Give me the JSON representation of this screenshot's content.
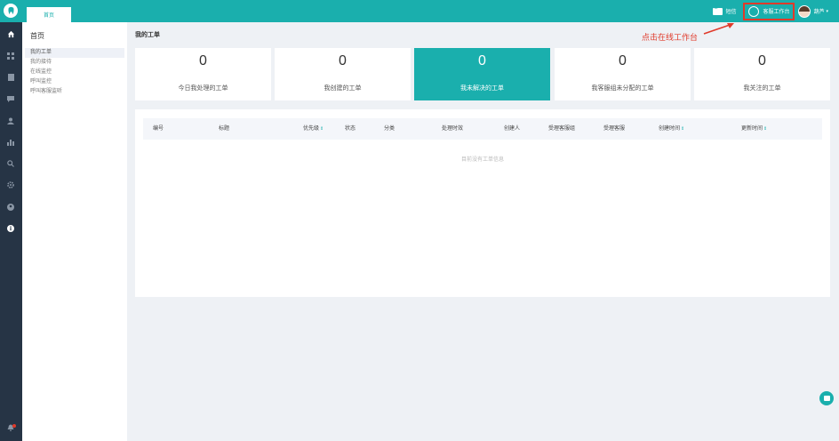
{
  "topbar": {
    "tab_home": "首页",
    "sms_label": "短信",
    "workbench_label": "客服工作台",
    "user_name": "葫芦",
    "user_caret": "▾"
  },
  "sidebar": {
    "title": "首页",
    "items": [
      {
        "label": "我的工单",
        "active": true
      },
      {
        "label": "我的接待",
        "active": false
      },
      {
        "label": "在线监控",
        "active": false
      },
      {
        "label": "呼叫监控",
        "active": false
      },
      {
        "label": "呼叫客服监听",
        "active": false
      }
    ]
  },
  "main": {
    "title": "我的工单",
    "cards": [
      {
        "value": "0",
        "label": "今日我处理的工单",
        "highlight": false
      },
      {
        "value": "0",
        "label": "我创建的工单",
        "highlight": false
      },
      {
        "value": "0",
        "label": "我未解决的工单",
        "highlight": true
      },
      {
        "value": "0",
        "label": "我客服组未分配的工单",
        "highlight": false
      },
      {
        "value": "0",
        "label": "我关注的工单",
        "highlight": false
      }
    ],
    "table": {
      "columns": [
        "编号",
        "标题",
        "优先级",
        "状态",
        "分类",
        "处理时效",
        "创建人",
        "受理客服组",
        "受理客服",
        "创建时间",
        "更新时间"
      ],
      "sort_glyph": "⇕",
      "empty_text": "目前没有工单信息"
    }
  },
  "annotation": {
    "text": "点击在线工作台"
  },
  "colors": {
    "accent": "#1aafad",
    "sidebar_dark": "#263445",
    "annotation": "#e03a2a"
  }
}
